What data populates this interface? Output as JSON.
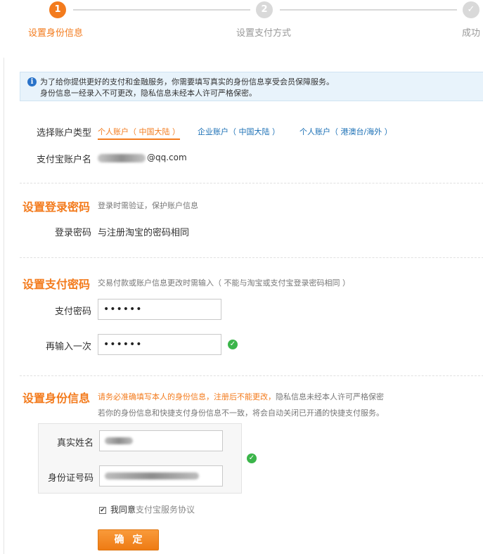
{
  "steps": [
    {
      "num": "1",
      "label": "设置身份信息",
      "state": "active"
    },
    {
      "num": "2",
      "label": "设置支付方式",
      "state": "inactive"
    },
    {
      "num": "",
      "label": "成功",
      "state": "inactive"
    }
  ],
  "notice": {
    "line1": "为了给你提供更好的支付和金融服务，你需要填写真实的身份信息享受会员保障服务。",
    "line2": "身份信息一经录入不可更改，隐私信息未经本人许可严格保密。"
  },
  "account": {
    "type_label": "选择账户类型",
    "options": [
      {
        "label": "个人账户（ 中国大陆 ）",
        "selected": true
      },
      {
        "label": "企业账户（ 中国大陆 ）",
        "selected": false
      },
      {
        "label": "个人账户（ 港澳台/海外 ）",
        "selected": false
      }
    ],
    "name_label": "支付宝账户名",
    "name_value_suffix": "@qq.com"
  },
  "login_pw": {
    "title": "设置登录密码",
    "desc": "登录时需验证，保护账户信息",
    "label": "登录密码",
    "value": "与注册淘宝的密码相同"
  },
  "pay_pw": {
    "title": "设置支付密码",
    "desc": "交易付款或账户信息更改时需输入（ 不能与淘宝或支付宝登录密码相同 ）",
    "pw_label": "支付密码",
    "pw_value": "••••••",
    "confirm_label": "再输入一次",
    "confirm_value": "••••••"
  },
  "identity": {
    "title": "设置身份信息",
    "warn": "请务必准确填写本人的身份信息，注册后不能更改，",
    "desc_rest": "隐私信息未经本人许可严格保密",
    "desc2": "若你的身份信息和快捷支付身份信息不一致，将会自动关闭已开通的快捷支付服务。",
    "name_label": "真实姓名",
    "id_label": "身份证号码"
  },
  "agreement": {
    "checkbox": "✔",
    "prefix": "我同意",
    "link": "支付宝服务协议"
  },
  "submit_label": "确定",
  "colors": {
    "accent": "#f37b1d",
    "link": "#1a6fb5",
    "success": "#3bb54a"
  },
  "icons": {
    "info": "info-icon",
    "check": "check-circle-icon",
    "step_done": "checkmark-icon"
  }
}
